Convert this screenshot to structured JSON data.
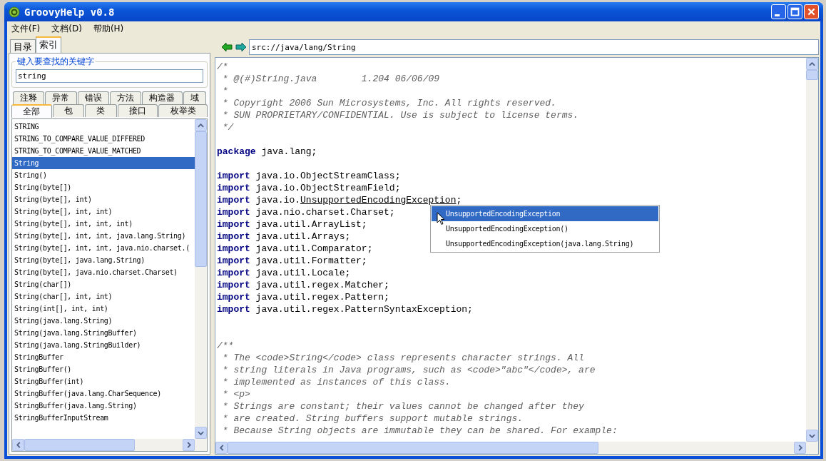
{
  "window": {
    "title": "GroovyHelp v0.8"
  },
  "menu": [
    "文件(F)",
    "文档(D)",
    "帮助(H)"
  ],
  "sidebar": {
    "tabs": [
      {
        "label": "目录",
        "selected": false
      },
      {
        "label": "索引",
        "selected": true
      }
    ],
    "search": {
      "label": "键入要查找的关键字",
      "value": "string"
    },
    "filter_tabs_back": [
      {
        "label": "注释",
        "selected": false
      },
      {
        "label": "异常",
        "selected": false
      },
      {
        "label": "错误",
        "selected": false
      },
      {
        "label": "方法",
        "selected": false
      },
      {
        "label": "构造器",
        "selected": false
      },
      {
        "label": "域",
        "selected": false
      }
    ],
    "filter_tabs_front": [
      {
        "label": "全部",
        "selected": true
      },
      {
        "label": "包",
        "selected": false
      },
      {
        "label": "类",
        "selected": false
      },
      {
        "label": "接口",
        "selected": false
      },
      {
        "label": "枚举类",
        "selected": false
      }
    ],
    "items": [
      {
        "label": "STRING",
        "selected": false
      },
      {
        "label": "STRING_TO_COMPARE_VALUE_DIFFERED",
        "selected": false
      },
      {
        "label": "STRING_TO_COMPARE_VALUE_MATCHED",
        "selected": false
      },
      {
        "label": "String",
        "selected": true
      },
      {
        "label": "String()",
        "selected": false
      },
      {
        "label": "String(byte[])",
        "selected": false
      },
      {
        "label": "String(byte[], int)",
        "selected": false
      },
      {
        "label": "String(byte[], int, int)",
        "selected": false
      },
      {
        "label": "String(byte[], int, int, int)",
        "selected": false
      },
      {
        "label": "String(byte[], int, int, java.lang.String)",
        "selected": false
      },
      {
        "label": "String(byte[], int, int, java.nio.charset.(",
        "selected": false
      },
      {
        "label": "String(byte[], java.lang.String)",
        "selected": false
      },
      {
        "label": "String(byte[], java.nio.charset.Charset)",
        "selected": false
      },
      {
        "label": "String(char[])",
        "selected": false
      },
      {
        "label": "String(char[], int, int)",
        "selected": false
      },
      {
        "label": "String(int[], int, int)",
        "selected": false
      },
      {
        "label": "String(java.lang.String)",
        "selected": false
      },
      {
        "label": "String(java.lang.StringBuffer)",
        "selected": false
      },
      {
        "label": "String(java.lang.StringBuilder)",
        "selected": false
      },
      {
        "label": "StringBuffer",
        "selected": false
      },
      {
        "label": "StringBuffer()",
        "selected": false
      },
      {
        "label": "StringBuffer(int)",
        "selected": false
      },
      {
        "label": "StringBuffer(java.lang.CharSequence)",
        "selected": false
      },
      {
        "label": "StringBuffer(java.lang.String)",
        "selected": false
      },
      {
        "label": "StringBufferInputStream",
        "selected": false
      }
    ]
  },
  "address": {
    "value": "src://java/lang/String"
  },
  "code": [
    {
      "kind": "comment",
      "text": "/*"
    },
    {
      "kind": "comment",
      "text": " * @(#)String.java        1.204 06/06/09"
    },
    {
      "kind": "comment",
      "text": " *"
    },
    {
      "kind": "comment",
      "text": " * Copyright 2006 Sun Microsystems, Inc. All rights reserved."
    },
    {
      "kind": "comment",
      "text": " * SUN PROPRIETARY/CONFIDENTIAL. Use is subject to license terms."
    },
    {
      "kind": "comment",
      "text": " */"
    },
    {
      "kind": "blank"
    },
    {
      "kind": "code",
      "keyword": "package",
      "text": " java.lang;"
    },
    {
      "kind": "blank"
    },
    {
      "kind": "code",
      "keyword": "import",
      "text": " java.io.ObjectStreamClass;"
    },
    {
      "kind": "code",
      "keyword": "import",
      "text": " java.io.ObjectStreamField;"
    },
    {
      "kind": "code",
      "keyword": "import",
      "text": " java.io.",
      "link": "UnsupportedEncodingException",
      "tail": ";"
    },
    {
      "kind": "code",
      "keyword": "import",
      "text": " java.nio.charset.Charset;"
    },
    {
      "kind": "code",
      "keyword": "import",
      "text": " java.util.ArrayList;"
    },
    {
      "kind": "code",
      "keyword": "import",
      "text": " java.util.Arrays;"
    },
    {
      "kind": "code",
      "keyword": "import",
      "text": " java.util.Comparator;"
    },
    {
      "kind": "code",
      "keyword": "import",
      "text": " java.util.Formatter;"
    },
    {
      "kind": "code",
      "keyword": "import",
      "text": " java.util.Locale;"
    },
    {
      "kind": "code",
      "keyword": "import",
      "text": " java.util.regex.Matcher;"
    },
    {
      "kind": "code",
      "keyword": "import",
      "text": " java.util.regex.Pattern;"
    },
    {
      "kind": "code",
      "keyword": "import",
      "text": " java.util.regex.PatternSyntaxException;"
    },
    {
      "kind": "blank"
    },
    {
      "kind": "blank"
    },
    {
      "kind": "comment",
      "text": "/**"
    },
    {
      "kind": "comment",
      "text": " * The <code>String</code> class represents character strings. All"
    },
    {
      "kind": "comment",
      "text": " * string literals in Java programs, such as <code>\"abc\"</code>, are"
    },
    {
      "kind": "comment",
      "text": " * implemented as instances of this class."
    },
    {
      "kind": "comment",
      "text": " * <p>"
    },
    {
      "kind": "comment",
      "text": " * Strings are constant; their values cannot be changed after they"
    },
    {
      "kind": "comment",
      "text": " * are created. String buffers support mutable strings."
    },
    {
      "kind": "comment",
      "text": " * Because String objects are immutable they can be shared. For example:"
    }
  ],
  "popup": [
    {
      "label": "UnsupportedEncodingException",
      "selected": true
    },
    {
      "label": "UnsupportedEncodingException()",
      "selected": false
    },
    {
      "label": "UnsupportedEncodingException(java.lang.String)",
      "selected": false
    }
  ]
}
